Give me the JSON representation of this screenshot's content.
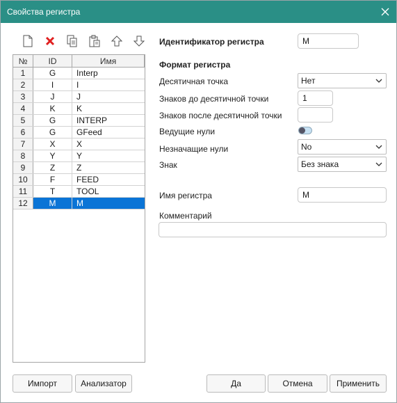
{
  "window": {
    "title": "Свойства регистра"
  },
  "toolbar": {
    "icons": [
      "new-file-icon",
      "delete-icon",
      "copy-icon",
      "paste-icon",
      "arrow-up-icon",
      "arrow-down-icon"
    ]
  },
  "table": {
    "headers": [
      "№",
      "ID",
      "Имя"
    ],
    "rows": [
      {
        "no": "1",
        "id": "G",
        "name": "Interp"
      },
      {
        "no": "2",
        "id": "I",
        "name": "I"
      },
      {
        "no": "3",
        "id": "J",
        "name": "J"
      },
      {
        "no": "4",
        "id": "K",
        "name": "K"
      },
      {
        "no": "5",
        "id": "G",
        "name": "INTERP"
      },
      {
        "no": "6",
        "id": "G",
        "name": "GFeed"
      },
      {
        "no": "7",
        "id": "X",
        "name": "X"
      },
      {
        "no": "8",
        "id": "Y",
        "name": "Y"
      },
      {
        "no": "9",
        "id": "Z",
        "name": "Z"
      },
      {
        "no": "10",
        "id": "F",
        "name": "FEED"
      },
      {
        "no": "11",
        "id": "T",
        "name": "TOOL"
      },
      {
        "no": "12",
        "id": "M",
        "name": "M"
      }
    ],
    "selected_row": "12"
  },
  "form": {
    "register_id_label": "Идентификатор регистра",
    "register_id_value": "M",
    "format_label": "Формат регистра",
    "decimal_point_label": "Десятичная точка",
    "decimal_point_value": "Нет",
    "digits_before_label": "Знаков до десятичной точки",
    "digits_before_value": "1",
    "digits_after_label": "Знаков после десятичной точки",
    "digits_after_value": "",
    "leading_zeros_label": "Ведущие нули",
    "leading_zeros_on": false,
    "trailing_zeros_label": "Незначащие нули",
    "trailing_zeros_value": "No",
    "sign_label": "Знак",
    "sign_value": "Без знака",
    "register_name_label": "Имя регистра",
    "register_name_value": "M",
    "comment_label": "Комментарий",
    "comment_value": ""
  },
  "buttons": {
    "import": "Импорт",
    "analyzer": "Анализатор",
    "ok": "Да",
    "cancel": "Отмена",
    "apply": "Применить"
  },
  "colors": {
    "titlebar": "#2a8f86",
    "selection": "#0a74d6",
    "delete_icon": "#e02020"
  }
}
